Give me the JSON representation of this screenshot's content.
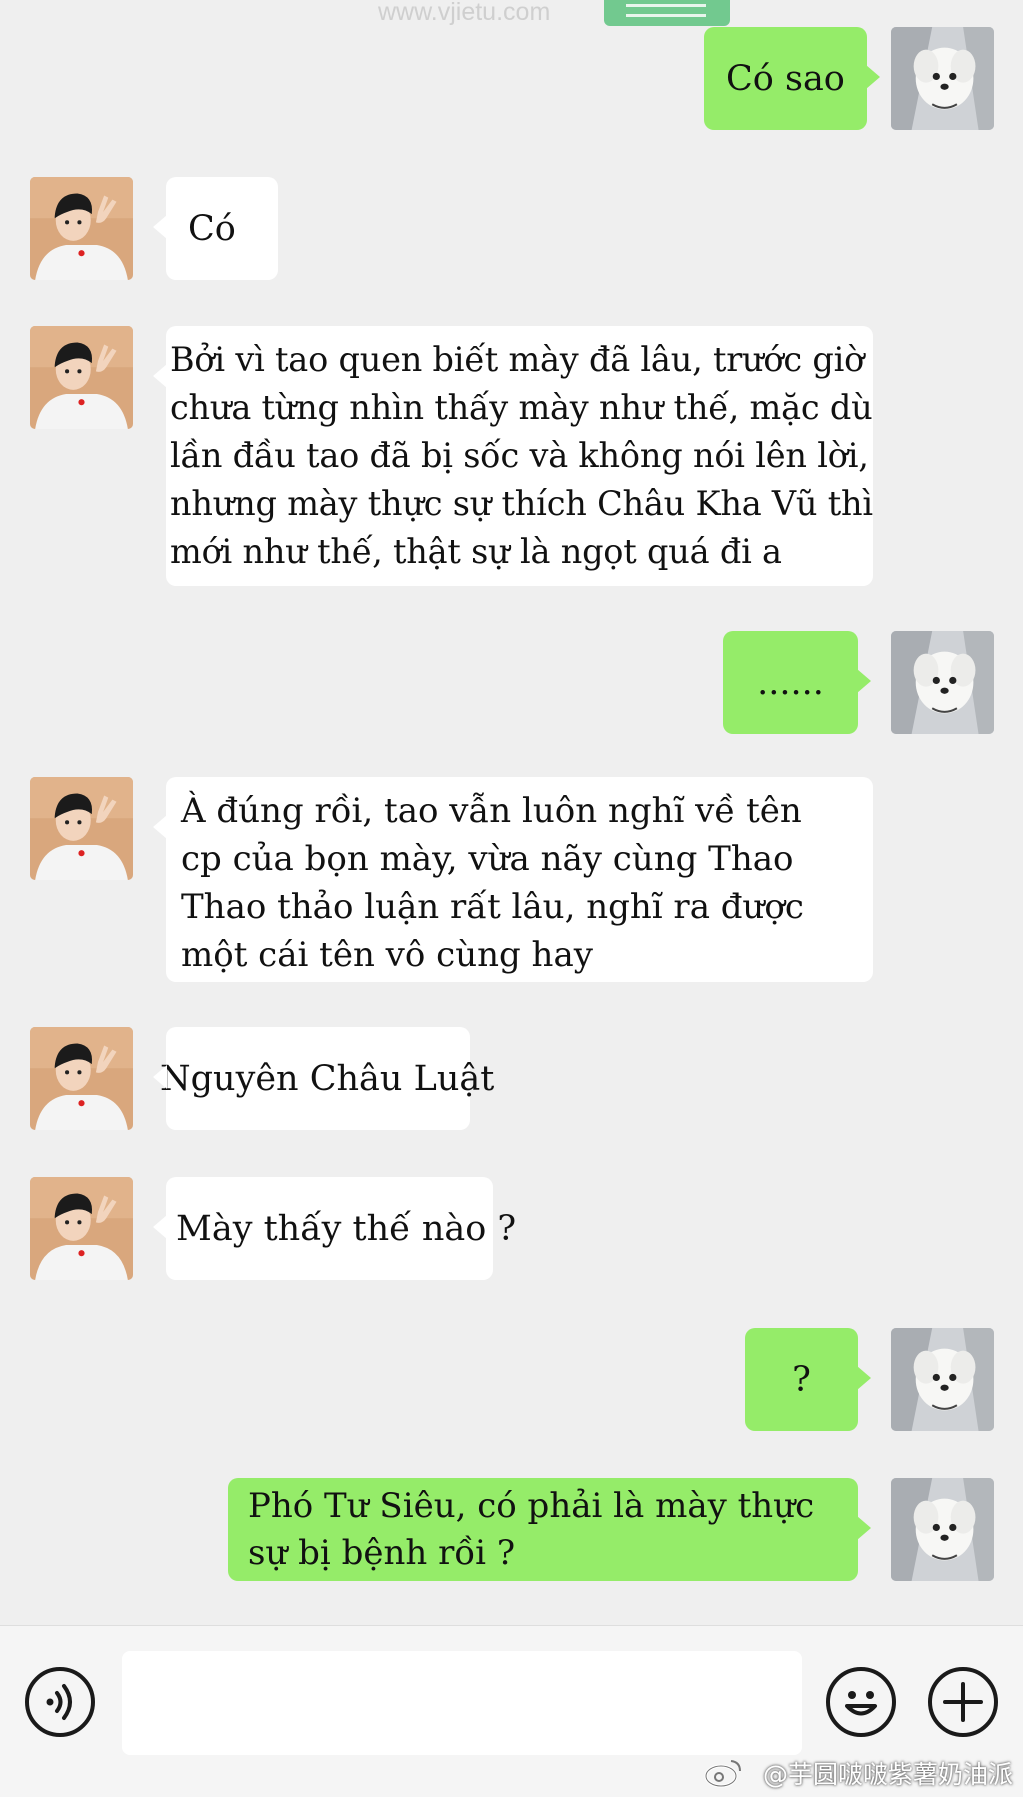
{
  "watermark_top": "www.vjietu.com",
  "watermark_bottom": "@芋圆啵啵紫薯奶油派",
  "colors": {
    "background": "#efefef",
    "incoming_bubble": "#ffffff",
    "outgoing_bubble": "#95ec69"
  },
  "icons": {
    "voice": "voice-icon",
    "emoji": "emoji-icon",
    "add": "plus-icon",
    "weibo": "weibo-logo-icon"
  },
  "messages": [
    {
      "side": "right",
      "sender": "dog-avatar",
      "text": "Có sao"
    },
    {
      "side": "left",
      "sender": "boy-avatar",
      "text": "Có"
    },
    {
      "side": "left",
      "sender": "boy-avatar",
      "text": "Bởi vì tao quen biết mày đã lâu, trước giờ chưa từng nhìn thấy mày như thế, mặc dù lần đầu tao đã bị sốc và không nói lên lời, nhưng mày thực sự thích Châu Kha Vũ thì mới như thế, thật sự là ngọt quá đi a"
    },
    {
      "side": "right",
      "sender": "dog-avatar",
      "text": "......"
    },
    {
      "side": "left",
      "sender": "boy-avatar",
      "text": "À đúng rồi, tao vẫn luôn nghĩ về tên cp của bọn mày, vừa nãy cùng Thao Thao thảo luận rất lâu, nghĩ ra được một cái tên vô cùng hay"
    },
    {
      "side": "left",
      "sender": "boy-avatar",
      "text": "Nguyên Châu Luật"
    },
    {
      "side": "left",
      "sender": "boy-avatar",
      "text": "Mày thấy thế nào ?"
    },
    {
      "side": "right",
      "sender": "dog-avatar",
      "text": "?"
    },
    {
      "side": "right",
      "sender": "dog-avatar",
      "text": "Phó Tư Siêu, có phải là mày thực sự bị bệnh rồi ?"
    }
  ],
  "input": {
    "value": ""
  }
}
